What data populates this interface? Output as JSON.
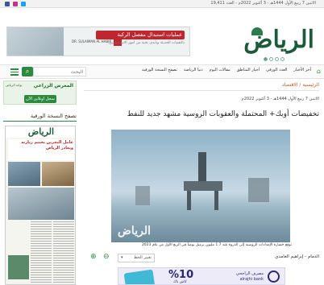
{
  "topbar": {
    "date": "الاثنين 7 ربيع الأول 1444هـ - 3 أكتوبر 2022م - العدد 19,411"
  },
  "header": {
    "logo_text": "الرياض",
    "ad": {
      "title": "عمليات استبدال مفصل الركبة",
      "subtitle": "بالتقنيات الحديثة وبأيدي نخبة من أمهر الاستشاريين",
      "hospital": "DR. SULAIMAN AL HABIB"
    }
  },
  "nav": {
    "search_placeholder": "البحث",
    "items": [
      "آخر الأخبار",
      "العدد الورقي",
      "أخبار المناطق",
      "مقالات اليوم",
      "دنيا الرياضة",
      "تصفح النسخة الورقية"
    ]
  },
  "sidebar": {
    "ad_title": "المعرض الزراعي",
    "ad_note": "بوابة الرياض",
    "ad_button": "سجل اونلاين الآن",
    "heading": "تصفح النسخة الورقية",
    "paper_mast": "الرياض",
    "paper_headline": "عامل البحرين يختتم زيارته ويغادر الرياض"
  },
  "main": {
    "breadcrumb": [
      "الرئيسية",
      "الاقتصاد"
    ],
    "breadcrumb_sep": "/",
    "date": "الاثنين 7 ربيع الأول 1444هـ - 3 أكتوبر 2022م",
    "title": "تخفيضات أوبك+ المحتملة والعقوبات الروسية مشهد جديد للنفط",
    "image_watermark": "الرياض",
    "caption": "توقع خسارة الإمدادات الروسية إلى الذروة عند 1.7 مليون برميل يومياً في الربع الأول من عام 2023",
    "author": "الدمام - إبراهيم الغامدي",
    "font_select": "تغيير الخط",
    "zoom_in": "⊕",
    "zoom_out": "⊖"
  },
  "bottom_ad": {
    "percent": "%10",
    "percent_sub": "كاش باك",
    "bank_name": "مصرف الراجحي",
    "bank_en": "alrajhi bank"
  },
  "colors": {
    "brand_green": "#2b8a3e",
    "logo_green": "#1b5a3a",
    "ad_red": "#c0262d",
    "breadcrumb_orange": "#cc5522"
  }
}
